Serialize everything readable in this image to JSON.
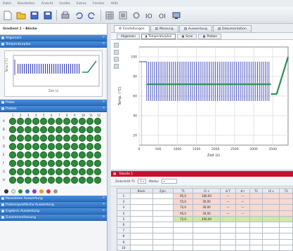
{
  "menu": {
    "items": [
      "Datei",
      "Bearbeiten",
      "Ansicht",
      "Geräte",
      "Extras",
      "Fenster",
      "Hilfe"
    ]
  },
  "toolbar": {
    "icons": [
      "new-document-icon",
      "open-folder-icon",
      "save-icon",
      "print-icon",
      "undo-icon",
      "redo-icon",
      "grid-icon",
      "list-icon",
      "settings-icon",
      "io-icon",
      "oi-icon",
      "monitor-icon"
    ]
  },
  "sidebar": {
    "title": "Gradient 1 – Blöcke",
    "sections": [
      "Allgemein",
      "Temperaturplan",
      "Probe",
      "Proben"
    ],
    "bottom_sections": [
      "Messdaten Auswertung",
      "Probenspezifische Auswertung",
      "Ergebnis Auswertung",
      "Zusammenfassung"
    ],
    "plate_columns": [
      "1",
      "2",
      "3",
      "4",
      "5",
      "6",
      "7",
      "8",
      "9",
      "10",
      "11",
      "12"
    ],
    "plate_rows": [
      "A",
      "B",
      "C",
      "D",
      "E",
      "F",
      "G",
      "H"
    ]
  },
  "main": {
    "tabs": [
      "Einstellungen",
      "Messung",
      "Auswertung",
      "Dokumentation"
    ],
    "subtabs": [
      "Allgemein",
      "Temperaturplan",
      "Scan",
      "Proben"
    ],
    "active_subtab": "Temperaturplan"
  },
  "plot": {
    "xlabel": "Zeit (s)",
    "ylabel": "Temp. (°C)",
    "xticks": [
      "0",
      "500",
      "1000",
      "1500",
      "2000",
      "2500",
      "3000",
      "3500"
    ],
    "yticks": [
      "100",
      "80",
      "60",
      "40",
      "20"
    ]
  },
  "chart_data": {
    "type": "line",
    "xlabel": "Zeit (s)",
    "ylabel": "Temp. (°C)",
    "xlim": [
      0,
      3900
    ],
    "ylim": [
      10,
      110
    ],
    "series": [
      {
        "color": "#3a46b8",
        "x": [
          0,
          60,
          60,
          200,
          200,
          3450
        ],
        "y": [
          95,
          95,
          55,
          55,
          72,
          72
        ]
      },
      {
        "color": "#2c8c5a",
        "x": [
          3450,
          3600,
          3900
        ],
        "y": [
          62,
          62,
          100
        ]
      }
    ]
  },
  "table": {
    "title": "Tabelle 1",
    "options_label": "Zeitschritt T1",
    "options_value": "0",
    "options_label2": "Modus",
    "headers": [
      "Block",
      "Zykl.",
      "T1",
      "t1 s",
      "Δ T",
      "Δ t",
      "T2",
      "t2 s",
      "T3"
    ],
    "rows": [
      [
        "",
        "",
        "95,0",
        "180,00",
        "---",
        "---",
        "",
        "",
        ""
      ],
      [
        "",
        "",
        "55,0",
        "30,00",
        "---",
        "---",
        "",
        "",
        ""
      ],
      [
        "",
        "",
        "72,0",
        "30,00",
        "---",
        "---",
        "",
        "",
        ""
      ],
      [
        "",
        "",
        "95,0",
        "30,00",
        "---",
        "---",
        "",
        "",
        ""
      ],
      [
        "",
        "",
        "72,0",
        "300,00",
        "",
        "",
        "",
        "",
        ""
      ],
      [
        "",
        "",
        "",
        "",
        "",
        "",
        "",
        "",
        ""
      ],
      [
        "",
        "",
        "",
        "",
        "",
        "",
        "",
        "",
        ""
      ],
      [
        "",
        "",
        "",
        "",
        "",
        "",
        "",
        "",
        ""
      ],
      [
        "",
        "",
        "",
        "",
        "",
        "",
        "",
        "",
        ""
      ],
      [
        "",
        "",
        "",
        "",
        "",
        "",
        "",
        "",
        ""
      ]
    ],
    "row_numbers": [
      "1",
      "2",
      "3",
      "4",
      "5",
      "6",
      "7",
      "8",
      "9",
      "10"
    ]
  },
  "colors": {
    "accent": "#2d6fc0",
    "well": "#2f8a3c",
    "table_header": "#c8102e"
  }
}
